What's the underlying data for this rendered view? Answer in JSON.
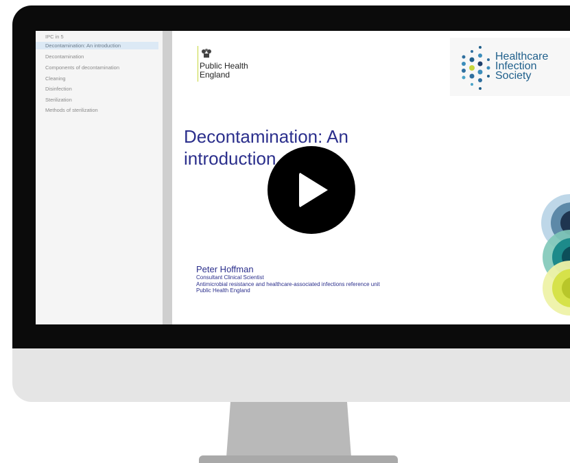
{
  "sidebar": {
    "items": [
      {
        "label": "IPC in 5",
        "active": false
      },
      {
        "label": "Decontamination: An introduction",
        "active": true
      },
      {
        "label": "Decontamination",
        "active": false
      },
      {
        "label": "Components of decontamination",
        "active": false
      },
      {
        "label": "Cleaning",
        "active": false
      },
      {
        "label": "Disinfection",
        "active": false
      },
      {
        "label": "Sterilization",
        "active": false
      },
      {
        "label": "Methods of sterilization",
        "active": false
      }
    ]
  },
  "slide": {
    "phe_logo": {
      "line1": "Public Health",
      "line2": "England"
    },
    "his_logo": {
      "line1": "Healthcare",
      "line2": "Infection",
      "line3": "Society"
    },
    "title_line1": "Decontamination: An",
    "title_line2": "introduction",
    "presenter": {
      "name": "Peter Hoffman",
      "role": "Consultant Clinical Scientist",
      "unit": "Antimicrobial resistance and healthcare-associated infections reference unit",
      "org": "Public Health England"
    }
  },
  "icons": {
    "play": "play-icon",
    "crest": "royal-crest-icon"
  },
  "colors": {
    "title": "#2b2f8c",
    "accent_green": "#c6d63a",
    "his_blue": "#1f5f8b",
    "active_item": "#dce9f5"
  }
}
